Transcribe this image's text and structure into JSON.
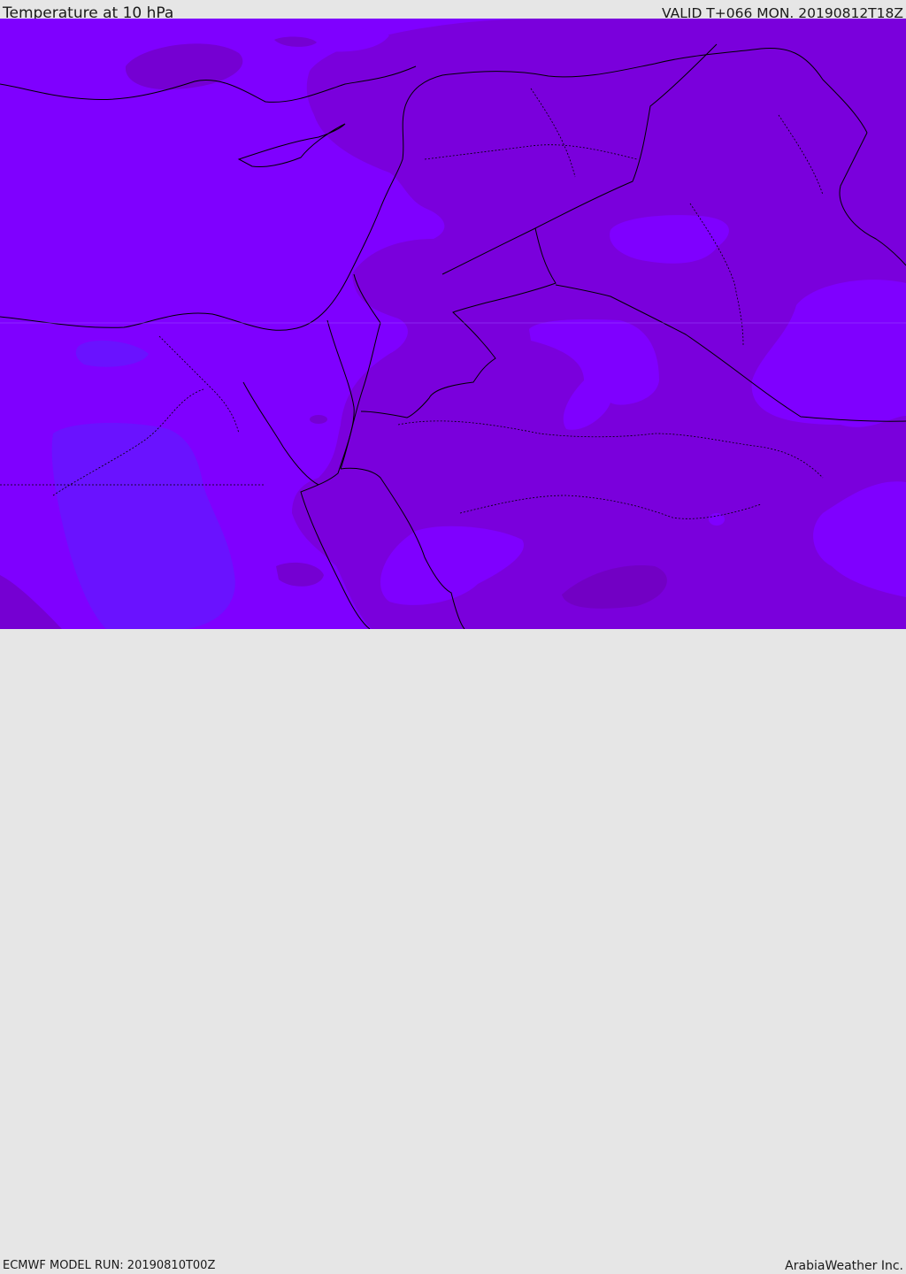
{
  "header": {
    "title": "Temperature at 10 hPa",
    "valid": "VALID T+066 MON. 20190812T18Z"
  },
  "footer": {
    "model_run": "ECMWF MODEL RUN: 20190810T00Z",
    "credit": "ArabiaWeather Inc."
  },
  "colors": {
    "band_base": "#7f00ff",
    "band_warm": "#7a00dc",
    "band_warmer": "#7300cd",
    "band_cool": "#6a12ff",
    "border": "#000000"
  }
}
